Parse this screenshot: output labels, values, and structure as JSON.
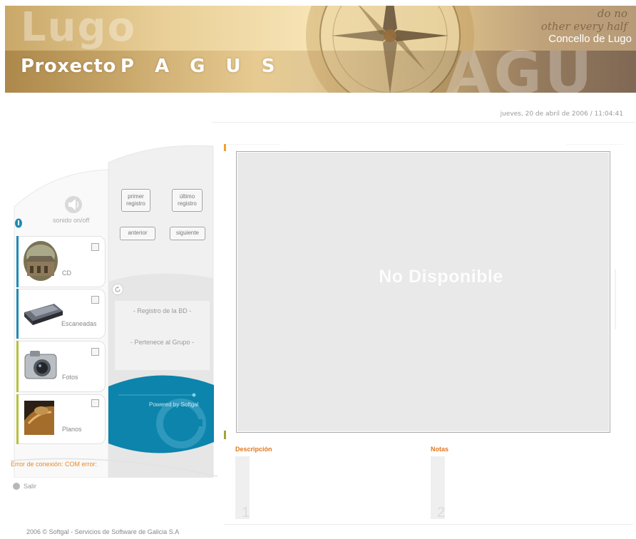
{
  "banner": {
    "ghost_title": "Lugo",
    "ghost_letters": "AGU",
    "title_prefix": "Proxecto",
    "title_main": "P A G U S",
    "right_label": "Concello de Lugo",
    "script_line1": "do no",
    "script_line2": "other every half"
  },
  "datetime": "jueves, 20 de abril de 2006  /  11:04:41",
  "sound": {
    "label": "sonido on/off",
    "icon": "speaker-icon"
  },
  "info_icon": "info-icon",
  "categories": [
    {
      "label": "CD",
      "icon": "cd-monastery-photo",
      "bar_color": "#1f8ab5"
    },
    {
      "label": "Escaneadas",
      "icon": "scanner-icon",
      "bar_color": "#1f8ab5"
    },
    {
      "label": "Fotos",
      "icon": "camera-icon",
      "bar_color": "#b6c23a"
    },
    {
      "label": "Planos",
      "icon": "blueprint-photo",
      "bar_color": "#b6c23a"
    }
  ],
  "nav": {
    "first_line1": "primer",
    "first_line2": "registro",
    "last_line1": "último",
    "last_line2": "registro",
    "prev": "anterior",
    "next": "siguiente"
  },
  "record": {
    "registro": "- Registro de la BD -",
    "grupo": "- Pertenece al Grupo -"
  },
  "powered_by": "Powered by Softgal",
  "error": "Error de conexión: COM error:",
  "exit": "Salir",
  "viewer": {
    "placeholder": "No Disponible"
  },
  "description": {
    "label": "Descripción",
    "number": "1"
  },
  "notes": {
    "label": "Notas",
    "number": "2"
  },
  "footer": "2006 © Softgal - Servicios de Software de Galicia S.A",
  "colors": {
    "accent_blue": "#1f8ab5",
    "accent_orange": "#e0781e",
    "accent_olive": "#b6c23a"
  }
}
